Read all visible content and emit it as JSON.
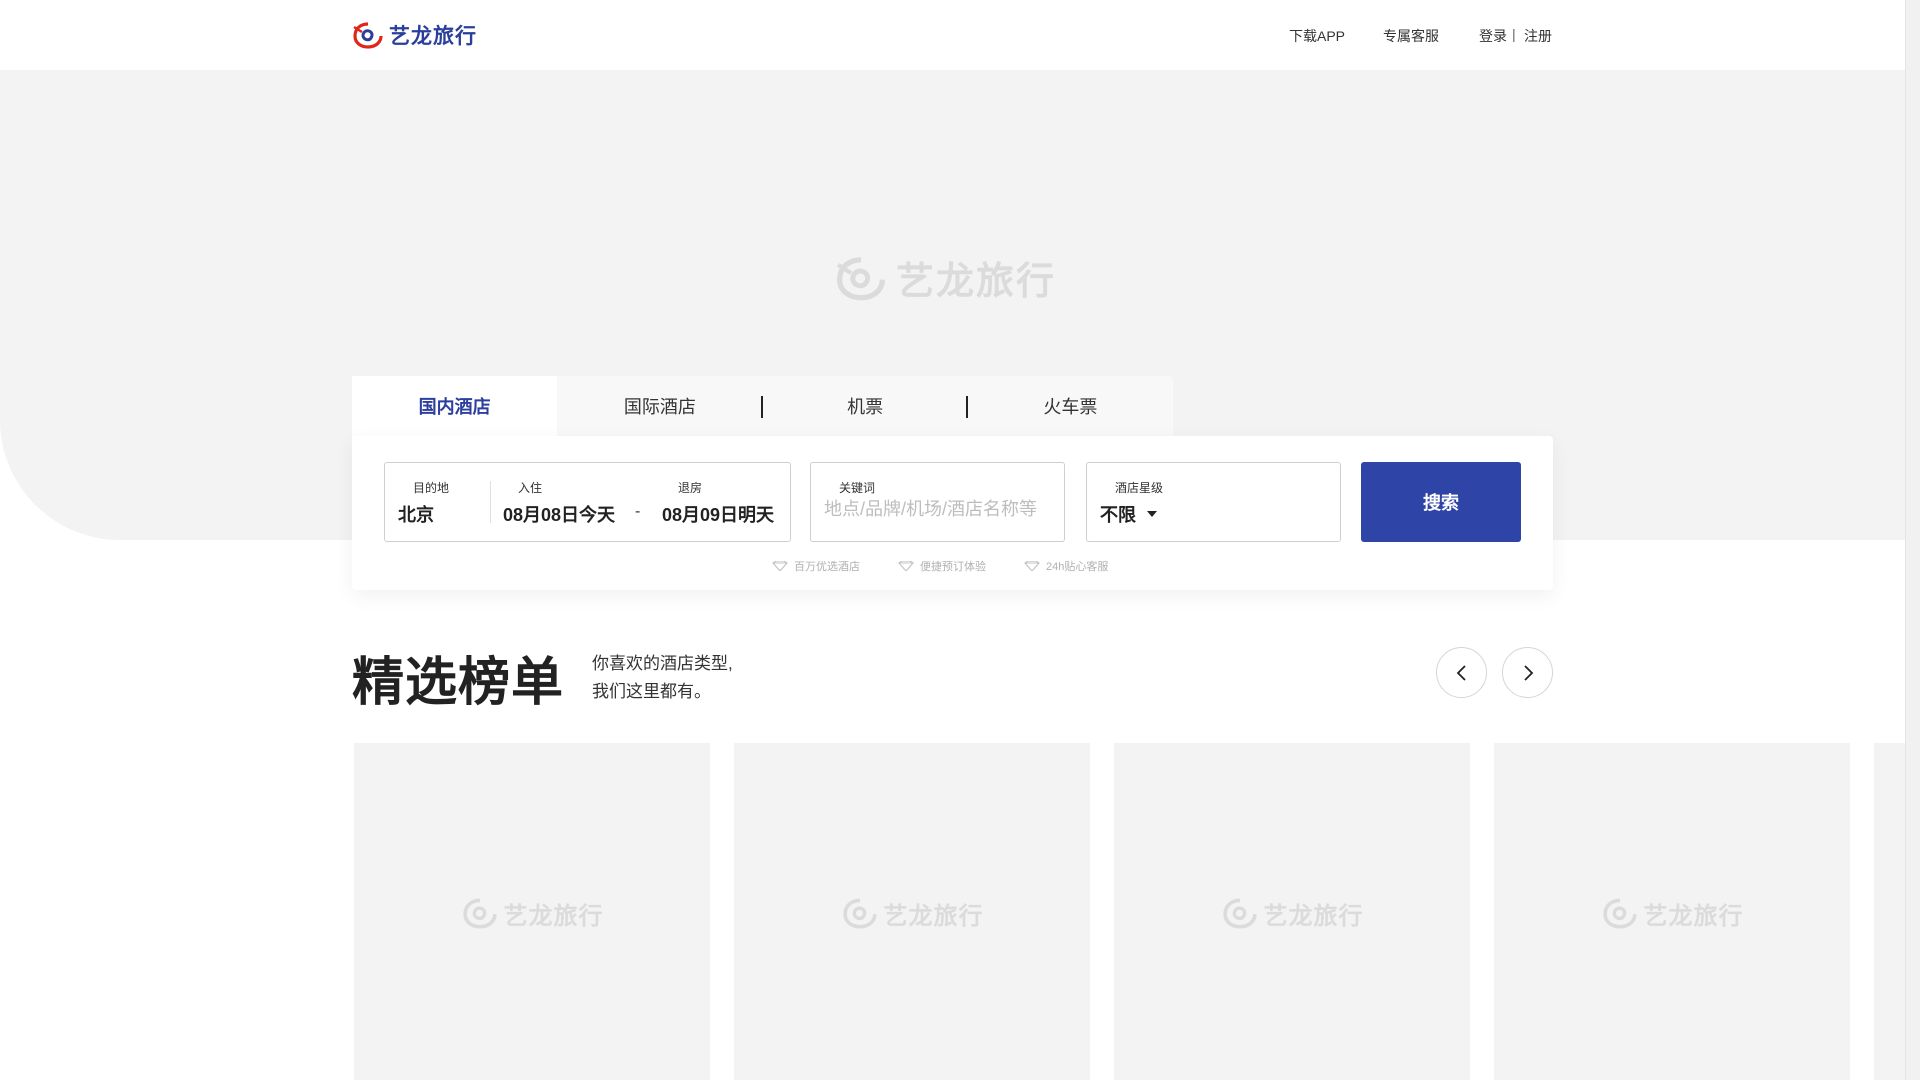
{
  "header": {
    "logo_text": "艺龙旅行",
    "nav_app": "下载APP",
    "nav_service": "专属客服",
    "nav_login": "登录",
    "nav_sep": "|",
    "nav_register": "注册"
  },
  "hero": {
    "watermark_text": "艺龙旅行"
  },
  "tabs": [
    {
      "label": "国内酒店",
      "active": true
    },
    {
      "label": "国际酒店",
      "active": false
    },
    {
      "label": "机票",
      "active": false
    },
    {
      "label": "火车票",
      "active": false
    }
  ],
  "search": {
    "destination_label": "目的地",
    "destination_value": "北京",
    "checkin_label": "入住",
    "checkin_value": "08月08日今天",
    "date_dash": "-",
    "checkout_label": "退房",
    "checkout_value": "08月09日明天",
    "keyword_label": "关键词",
    "keyword_placeholder": "地点/品牌/机场/酒店名称等",
    "star_label": "酒店星级",
    "star_value": "不限",
    "search_button": "搜索"
  },
  "features": [
    "百万优选酒店",
    "便捷预订体验",
    "24h贴心客服"
  ],
  "rank": {
    "title": "精选榜单",
    "subtitle_line1": "你喜欢的酒店类型,",
    "subtitle_line2": "我们这里都有。"
  },
  "cards": [
    {
      "watermark": "艺龙旅行"
    },
    {
      "watermark": "艺龙旅行"
    },
    {
      "watermark": "艺龙旅行"
    },
    {
      "watermark": "艺龙旅行"
    }
  ],
  "colors": {
    "brand": "#2e44a6",
    "logo_red": "#e1251b",
    "hero_bg": "#f3f3f3"
  }
}
